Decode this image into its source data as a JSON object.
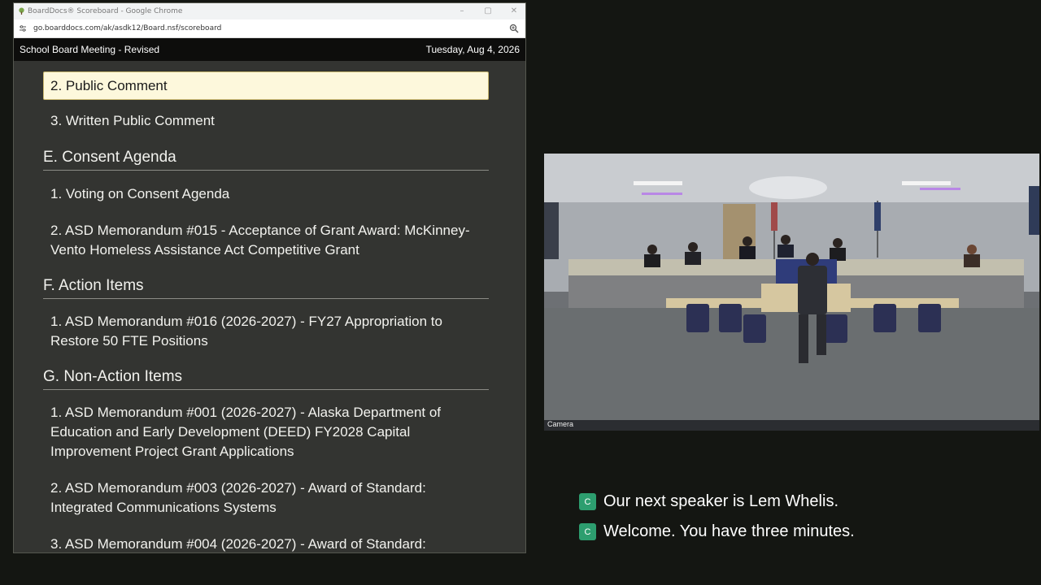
{
  "browser": {
    "tab_title": "BoardDocs® Scoreboard - Google Chrome",
    "url": "go.boarddocs.com/ak/asdk12/Board.nsf/scoreboard"
  },
  "header": {
    "meeting_title": "School Board Meeting - Revised",
    "date": "Tuesday, Aug 4, 2026"
  },
  "agenda": {
    "items": [
      {
        "type": "item",
        "text": "2. Public Comment",
        "active": true
      },
      {
        "type": "item",
        "text": "3. Written Public Comment"
      },
      {
        "type": "section",
        "text": "E. Consent Agenda"
      },
      {
        "type": "item",
        "text": "1. Voting on Consent Agenda"
      },
      {
        "type": "item",
        "text": "2. ASD Memorandum #015 - Acceptance of Grant Award: McKinney-Vento Homeless Assistance Act Competitive Grant"
      },
      {
        "type": "section",
        "text": "F. Action Items"
      },
      {
        "type": "item",
        "text": "1. ASD Memorandum #016 (2026-2027) - FY27 Appropriation to Restore 50 FTE Positions"
      },
      {
        "type": "section",
        "text": "G. Non-Action Items"
      },
      {
        "type": "item",
        "text": "1. ASD Memorandum #001 (2026-2027) - Alaska Department of Education and Early Development (DEED) FY2028 Capital Improvement Project Grant Applications"
      },
      {
        "type": "item",
        "text": "2. ASD Memorandum #003 (2026-2027) - Award of Standard: Integrated Communications Systems"
      },
      {
        "type": "item",
        "text": "3. ASD Memorandum #004 (2026-2027) - Award of Standard:"
      }
    ]
  },
  "video": {
    "label": "Camera"
  },
  "captions": [
    {
      "badge": "C",
      "text": "Our next speaker is Lem Whelis."
    },
    {
      "badge": "C",
      "text": "Welcome. You have three minutes."
    }
  ]
}
